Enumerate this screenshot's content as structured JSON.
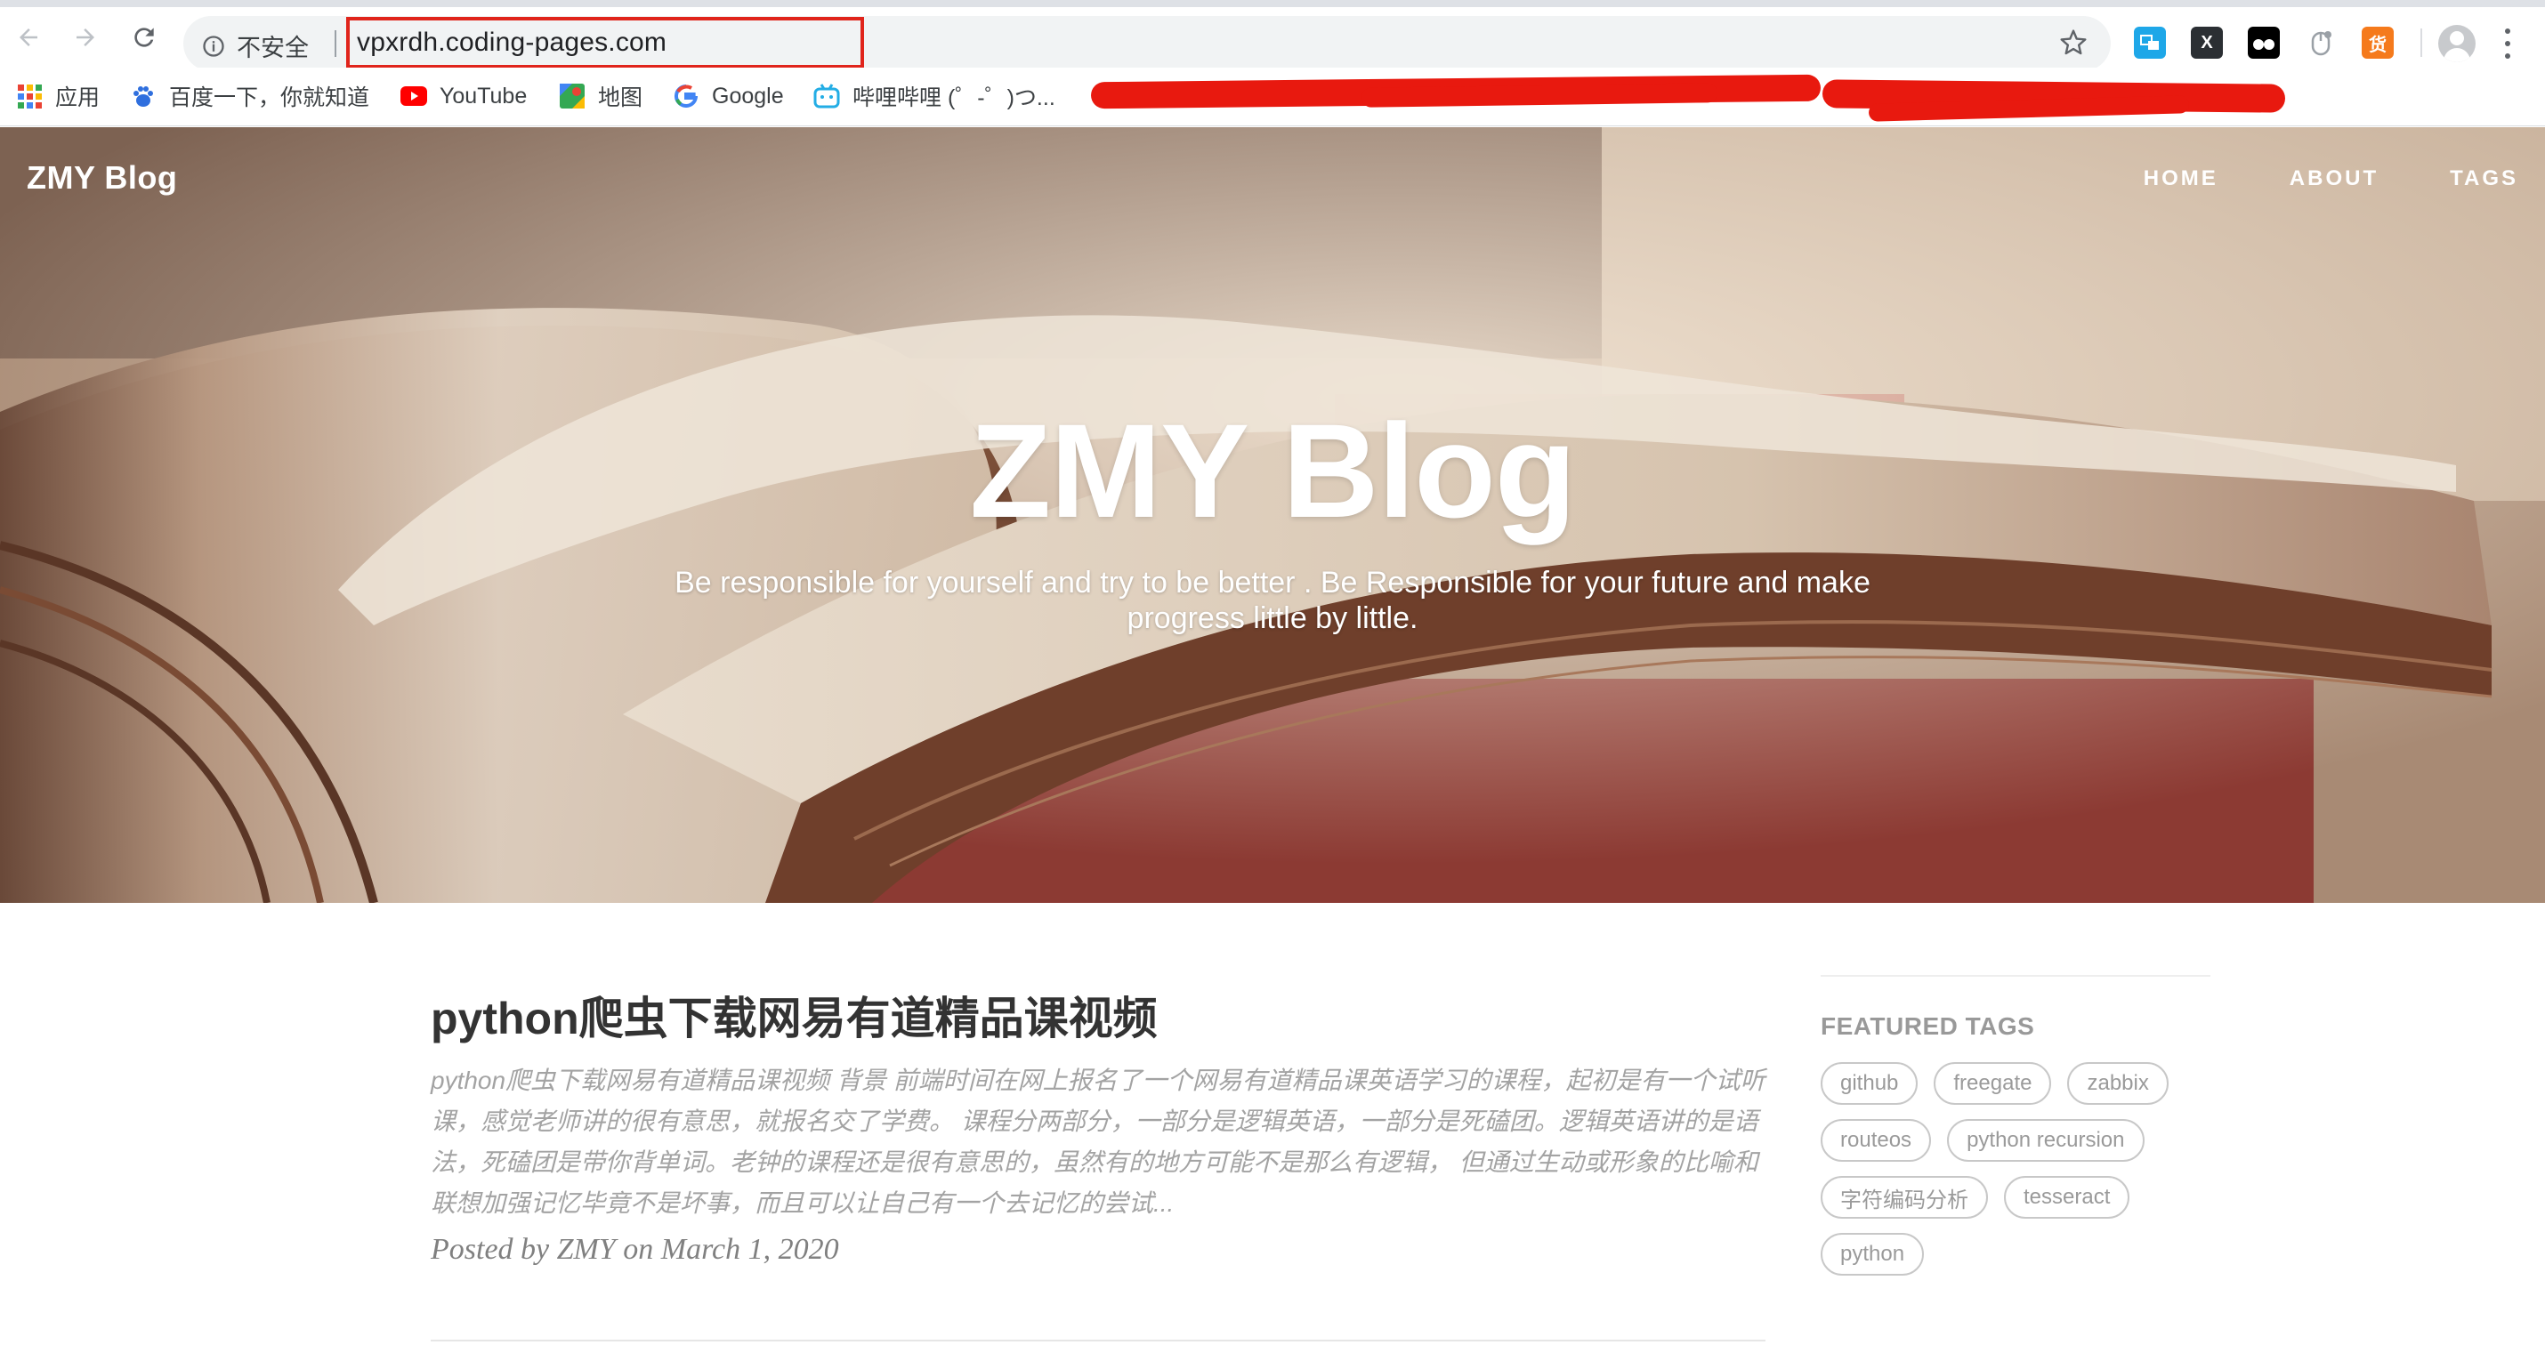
{
  "browser": {
    "security_label": "不安全",
    "url": "vpxrdh.coding-pages.com",
    "bookmarks": [
      {
        "label": "应用",
        "icon": "apps-grid-icon"
      },
      {
        "label": "百度一下，你就知道",
        "icon": "baidu-paw-icon"
      },
      {
        "label": "YouTube",
        "icon": "youtube-icon"
      },
      {
        "label": "地图",
        "icon": "maps-icon"
      },
      {
        "label": "Google",
        "icon": "google-icon"
      },
      {
        "label": "哔哩哔哩 (゜-゜)つ...",
        "icon": "bilibili-icon"
      }
    ],
    "extensions": [
      {
        "icon": "translate-extension-icon",
        "color": "#1ea7e8"
      },
      {
        "icon": "x-extension-icon",
        "color": "#2b2f33",
        "glyph": "X"
      },
      {
        "icon": "tampermonkey-icon",
        "color": "#000000"
      },
      {
        "icon": "mouse-extension-icon",
        "color": "#9aa0a6"
      },
      {
        "icon": "huo-extension-icon",
        "color": "#f57a1c",
        "glyph": "货"
      }
    ],
    "redaction_color": "#e8190f",
    "url_highlight_color": "#e0241b"
  },
  "site": {
    "brand": "ZMY Blog",
    "nav": [
      "HOME",
      "ABOUT",
      "TAGS"
    ],
    "hero_title": "ZMY Blog",
    "hero_subtitle": "Be responsible for yourself and try to be better . Be Responsible for your future and make progress little by little."
  },
  "post": {
    "title": "python爬虫下载网易有道精品课视频",
    "excerpt": "python爬虫下载网易有道精品课视频 背景 前端时间在网上报名了一个网易有道精品课英语学习的课程，起初是有一个试听课，感觉老师讲的很有意思，就报名交了学费。 课程分两部分，一部分是逻辑英语，一部分是死磕团。逻辑英语讲的是语法，死磕团是带你背单词。老钟的课程还是很有意思的，虽然有的地方可能不是那么有逻辑， 但通过生动或形象的比喻和联想加强记忆毕竟不是坏事，而且可以让自己有一个去记忆的尝试...",
    "meta": "Posted by ZMY on March 1, 2020"
  },
  "sidebar": {
    "featured_title": "FEATURED TAGS",
    "tags": [
      "github",
      "freegate",
      "zabbix",
      "routeos",
      "python recursion",
      "字符编码分析",
      "tesseract",
      "python"
    ]
  }
}
